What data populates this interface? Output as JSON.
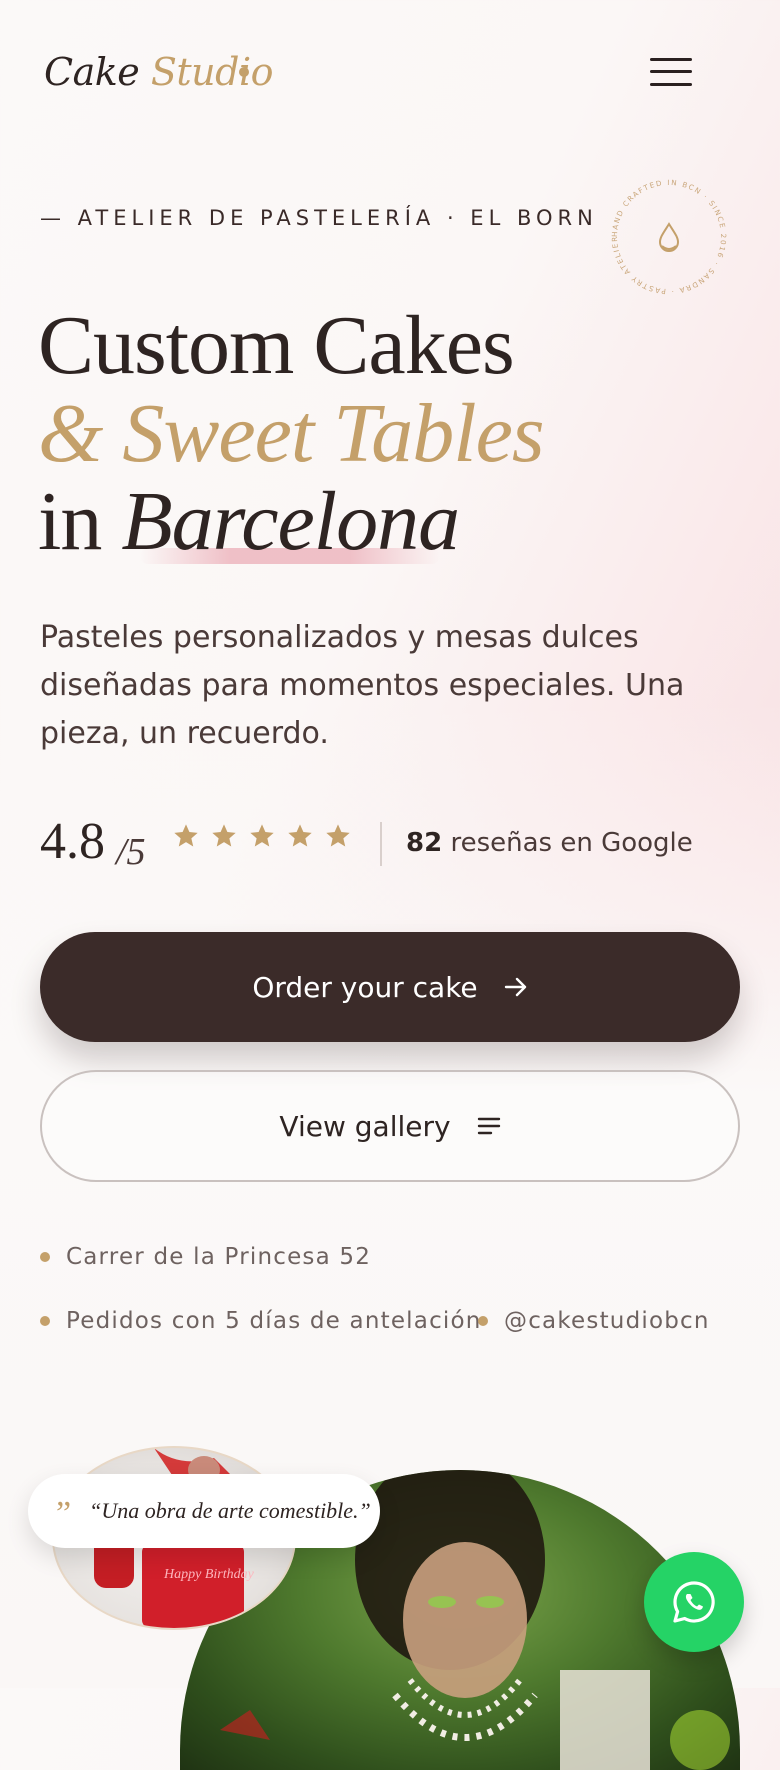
{
  "header": {
    "logo_part1": "Cake",
    "logo_part2": "Studio",
    "menu_icon": "hamburger-menu-icon"
  },
  "hero": {
    "eyebrow": "— ATELIER DE PASTELERÍA · EL BORN",
    "badge_text": "HAND CRAFTED IN BCN · SINCE 2016 · SANDRA · PASTRY ATELIER ·",
    "badge_icon": "drop-icon",
    "line1": "Custom Cakes",
    "line2": "& Sweet Tables",
    "line3_prefix": "in",
    "line3_accent": "Barcelona",
    "lead": "Pasteles personalizados y mesas dulces diseñadas para momentos especiales. Una pieza, un recuerdo."
  },
  "rating": {
    "score": "4.8",
    "out_of": "/5",
    "stars": 5,
    "reviews_count": "82",
    "reviews_label": "reseñas en Google"
  },
  "buttons": {
    "primary_label": "Order your cake",
    "primary_icon": "arrow-right-icon",
    "secondary_label": "View gallery",
    "secondary_icon": "list-lines-icon"
  },
  "info": {
    "address": "Carrer de la Princesa 52",
    "notice": "Pedidos con 5 días de antelación",
    "instagram": "@cakestudiobcn"
  },
  "testimonial": {
    "quote": "“Una obra de arte comestible.”"
  },
  "cake_text": "Happy Birthday",
  "colors": {
    "accent_gold": "#c4a06a",
    "dark_brown": "#3b2b29",
    "whatsapp_green": "#25d366",
    "blush": "#f6d5d9"
  },
  "floating": {
    "whatsapp_icon": "whatsapp-icon"
  }
}
